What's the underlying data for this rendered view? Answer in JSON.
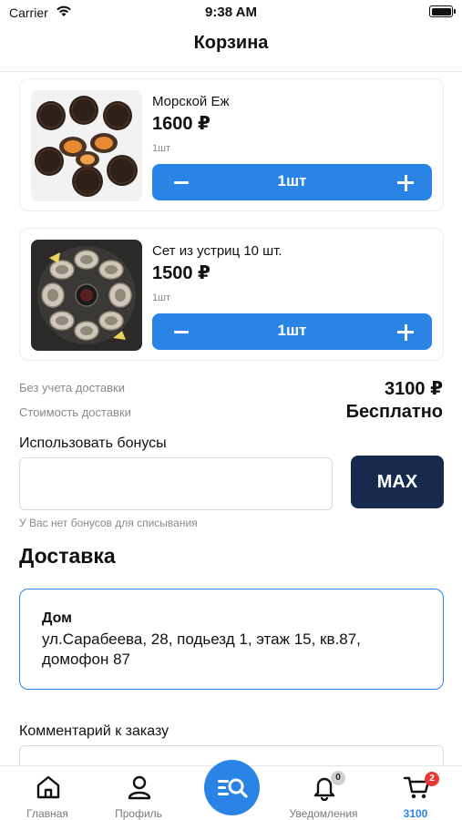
{
  "status_bar": {
    "carrier": "Carrier",
    "time": "9:38 AM"
  },
  "nav": {
    "title": "Корзина"
  },
  "cart": {
    "items": [
      {
        "name": "Морской Еж",
        "price": "1600 ₽",
        "unit": "1шт",
        "quantity": "1шт",
        "image": "sea-urchin-photo"
      },
      {
        "name": "Сет из устриц 10 шт.",
        "price": "1500 ₽",
        "unit": "1шт",
        "quantity": "1шт",
        "image": "oyster-set-photo"
      }
    ]
  },
  "summary": {
    "subtotal_label": "Без учета доставки",
    "subtotal_value": "3100 ₽",
    "delivery_label": "Стоимость доставки",
    "delivery_value": "Бесплатно"
  },
  "bonus": {
    "title": "Использовать бонусы",
    "input_value": "",
    "max_label": "MAX",
    "note": "У Вас нет бонусов для списывания"
  },
  "delivery": {
    "title": "Доставка",
    "address_name": "Дом",
    "address_text": "ул.Сарабеева, 28, подьезд 1, этаж 15, кв.87, домофон 87"
  },
  "comment": {
    "label": "Комментарий к заказу"
  },
  "tab_bar": {
    "home": {
      "label": "Главная",
      "icon": "home-icon"
    },
    "profile": {
      "label": "Профиль",
      "icon": "user-icon"
    },
    "center": {
      "icon": "search-menu-icon"
    },
    "notifications": {
      "label": "Уведомления",
      "icon": "bell-icon",
      "badge": "0"
    },
    "cart": {
      "label": "3100",
      "icon": "cart-icon",
      "badge": "2"
    }
  },
  "colors": {
    "accent": "#2a84e6",
    "dark_button": "#152a4d",
    "badge_red": "#e53935"
  }
}
